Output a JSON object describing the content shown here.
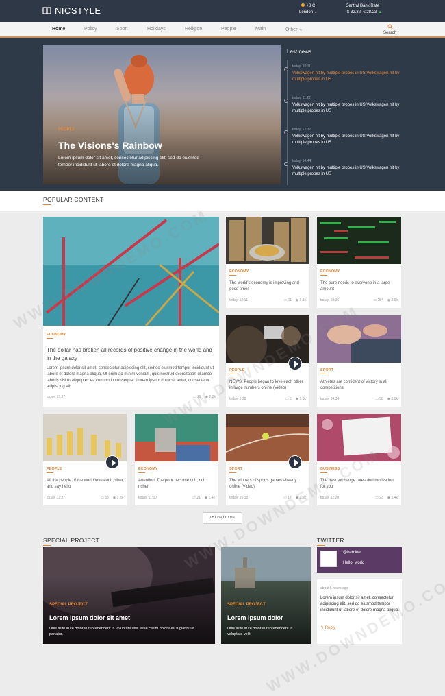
{
  "brand": {
    "name": "NICSTYLE"
  },
  "weather": {
    "temp": "+8 C",
    "city": "London"
  },
  "rates": {
    "title": "Central Bank Rate",
    "usd": "$ 32.32",
    "eur": "€ 28.23"
  },
  "nav": {
    "items": [
      "Home",
      "Policy",
      "Sport",
      "Holidays",
      "Religion",
      "People",
      "Main",
      "Other"
    ],
    "search": "Search"
  },
  "hero": {
    "category": "PEOPLE",
    "title": "The Visions's Rainbow",
    "text": "Lorem ipsum dolor sit amet, consectetur adipiscing elit, sed do eiusmod tempor incididunt ut labore et dolore magna aliqua."
  },
  "last_news": {
    "title": "Last news",
    "items": [
      {
        "time": "today, 10:11",
        "text": "Volkswagen hit by multiple probes in US Volkswagen hit by multiple probes in US"
      },
      {
        "time": "today, 11:22",
        "text": "Volkswagen hit by multiple probes in US Volkswagen hit by multiple probes in US"
      },
      {
        "time": "today, 12:32",
        "text": "Volkswagen hit by multiple probes in US Volkswagen hit by multiple probes in US"
      },
      {
        "time": "today, 14:44",
        "text": "Volkswagen hit by multiple probes in US Volkswagen hit by multiple probes in US"
      }
    ]
  },
  "popular": {
    "title": "POPULAR CONTENT",
    "big": {
      "category": "ECONOMY",
      "title": "The dollar has broken all records of positive change in the world and in the galaxy",
      "text": "Lorem ipsum dolor sit amet, consectetur adipiscing elit, sed do eiusmod tempor incididunt ut labore et dolore magna aliqua. Ut enim ad minim veniam, quis nostrud exercitation ullamco laboris nisi ut aliquip ex ea commodo consequat. Lorem ipsum dolor sit amet, consectetur adipiscing elit",
      "time": "today, 15:37",
      "comments": "29",
      "views": "2.3k"
    },
    "cards": [
      {
        "category": "ECONOMY",
        "text": "The world's economy is improving and good times",
        "time": "today, 12:11",
        "comments": "11",
        "views": "1.1k"
      },
      {
        "category": "ECONOMY",
        "text": "The euro needs to everyone in a large amount",
        "time": "today, 19:36",
        "comments": "254",
        "views": "2.9k"
      },
      {
        "category": "PEOPLE",
        "text": "NEWS: People began to love each other in large numbers online (Video)",
        "time": "today, 3:39",
        "comments": "5",
        "views": "1.3k"
      },
      {
        "category": "SPORT",
        "text": "Athletes are confident of victory in all competitions",
        "time": "today, 14:34",
        "comments": "58",
        "views": "8.8k"
      },
      {
        "category": "PEOPLE",
        "text": "All the people of the world love each other and say hello",
        "time": "today, 12:37",
        "comments": "33",
        "views": "1.2k"
      },
      {
        "category": "ECONOMY",
        "text": "Attention. The poor become rich, rich richer",
        "time": "today, 11:30",
        "comments": "21",
        "views": "1.4k"
      },
      {
        "category": "SPORT",
        "text": "The winners of sports games already online (Video)",
        "time": "today, 15:38",
        "comments": "17",
        "views": "2.9k"
      },
      {
        "category": "BUSINESS",
        "text": "The best exchange rates and motivation for you",
        "time": "today, 12:20",
        "comments": "23",
        "views": "5.4k"
      }
    ],
    "load_more": "Load more"
  },
  "special": {
    "title": "SPECIAL PROJECT",
    "items": [
      {
        "category": "SPECIAL PROJECT",
        "title": "Lorem ipsum dolor sit amet",
        "text": "Duis aute irure dolor in reprehenderit in voluptate velit esse cillum dolore eu fugiat nulla pariatur."
      },
      {
        "category": "SPECIAL PROJECT",
        "title": "Lorem ipsum dolor",
        "text": "Duis aute irure dolor in reprehenderit in voluptate velit."
      }
    ]
  },
  "twitter": {
    "title": "TWITTER",
    "handle": "@barclee",
    "hello": "Hello, world",
    "time": "about 5 hours ago",
    "text": "Lorem ipsum dolor sit amet, consectetur adipiscing elit, sed do eiusmod tempor incididunt ut labore et dolore magna aliqua.",
    "reply": "Reply"
  },
  "watermark": "WWW.DOWNDEMO.COM",
  "colors": {
    "accent": "#e58a3c",
    "dark": "#2e3846"
  }
}
